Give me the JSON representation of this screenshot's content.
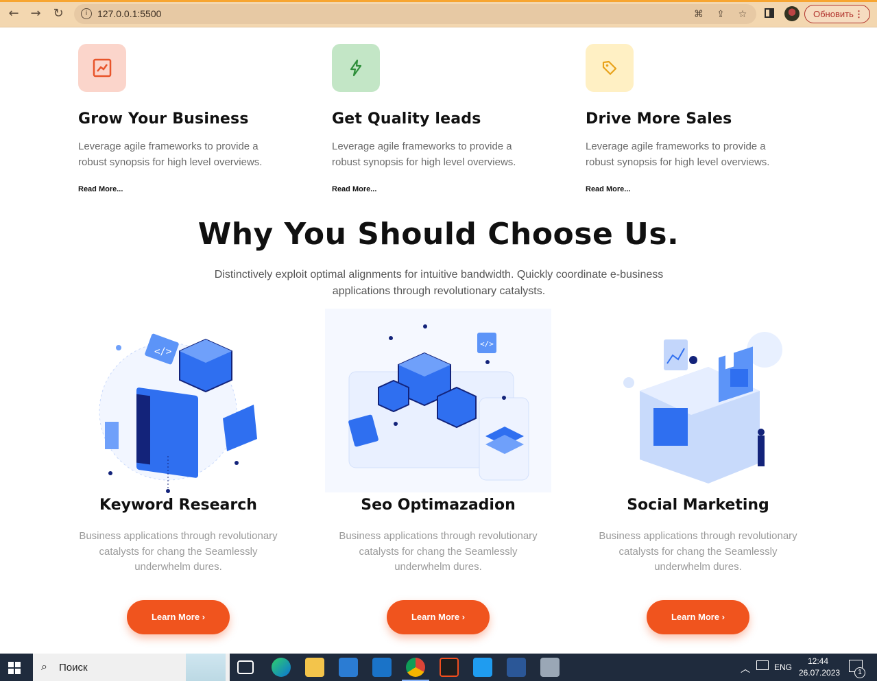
{
  "browser": {
    "url": "127.0.0.1:5500",
    "update_label": "Обновить",
    "menu_glyph": "⋮"
  },
  "features": [
    {
      "title": "Grow Your Business",
      "text": "Leverage agile frameworks to provide a robust synopsis for high level overviews.",
      "link": "Read More...",
      "icon": "chart-trend-icon",
      "bg": "#fbd5cb",
      "color": "#e8542a"
    },
    {
      "title": "Get Quality leads",
      "text": "Leverage agile frameworks to provide a robust synopsis for high level overviews.",
      "link": "Read More...",
      "icon": "lightning-icon",
      "bg": "#c3e6c6",
      "color": "#2e8f3a"
    },
    {
      "title": "Drive More Sales",
      "text": "Leverage agile frameworks to provide a robust synopsis for high level overviews.",
      "link": "Read More...",
      "icon": "tag-icon",
      "bg": "#fff0c4",
      "color": "#e8a21a"
    }
  ],
  "why": {
    "title": "Why You Should Choose Us.",
    "subtitle": "Distinctively exploit optimal alignments for intuitive bandwidth. Quickly coordinate e-business applications through revolutionary catalysts."
  },
  "services": [
    {
      "title": "Keyword Research",
      "text": "Business applications through revolutionary catalysts for chang the Seamlessly underwhelm dures.",
      "cta": "Learn More ›"
    },
    {
      "title": "Seo Optimazadion",
      "text": "Business applications through revolutionary catalysts for chang the Seamlessly underwhelm dures.",
      "cta": "Learn More ›"
    },
    {
      "title": "Social Marketing",
      "text": "Business applications through revolutionary catalysts for chang the Seamlessly underwhelm dures.",
      "cta": "Learn More ›"
    }
  ],
  "taskbar": {
    "search_placeholder": "Поиск",
    "lang": "ENG",
    "time": "12:44",
    "date": "26.07.2023",
    "notifications": "1"
  },
  "colors": {
    "accent": "#f0541e",
    "illustration_blue": "#2f6ff0"
  }
}
